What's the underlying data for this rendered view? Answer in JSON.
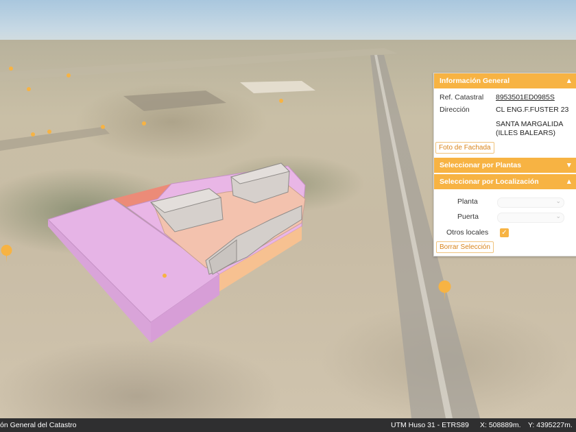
{
  "info_panel": {
    "title": "Información General",
    "ref_label": "Ref. Catastral",
    "ref_value": "8953501ED0985S",
    "dir_label": "Dirección",
    "dir_line1": "CL ENG.F.FUSTER 23",
    "dir_line2": "SANTA MARGALIDA",
    "dir_line3": "(ILLES BALEARS)",
    "foto_button": "Foto de Fachada"
  },
  "plantas_section": {
    "title": "Seleccionar por Plantas"
  },
  "localizacion_section": {
    "title": "Seleccionar por Localización",
    "planta_label": "Planta",
    "puerta_label": "Puerta",
    "otros_label": "Otros locales",
    "otros_checked": true,
    "borrar_button": "Borrar Selección"
  },
  "status_bar": {
    "left_text": "ón General del Catastro",
    "projection": "UTM Huso 31 - ETRS89",
    "x_coord": "X: 508889m.",
    "y_coord": "Y: 4395227m."
  },
  "colors": {
    "accent": "#f7b343",
    "parcel_pink": "#e6b4e6",
    "building_salmon": "#f3b79e",
    "building_orange": "#f7c191",
    "building_gray": "#d4cfcb"
  }
}
